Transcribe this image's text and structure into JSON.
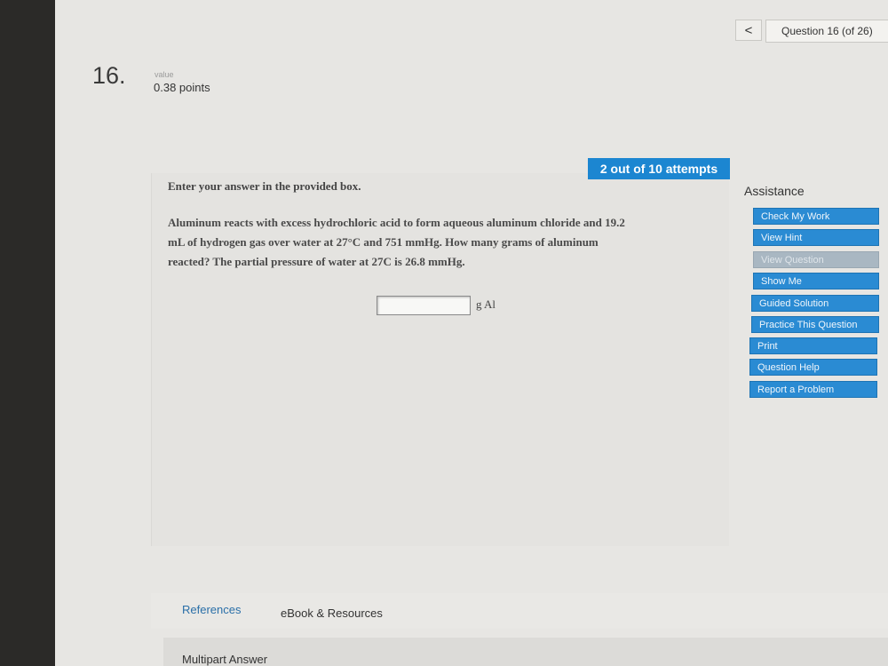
{
  "nav": {
    "prev_symbol": "<",
    "question_counter": "Question 16 (of 26)"
  },
  "question": {
    "number": "16.",
    "value_label": "value",
    "points": "0.38 points",
    "attempts": "2 out of 10 attempts",
    "instruction": "Enter your answer in the provided box.",
    "lines": [
      "Aluminum reacts with excess hydrochloric acid to form aqueous aluminum chloride and 19.2",
      "mL of hydrogen gas over water at 27°C and 751 mmHg. How many grams of aluminum",
      "reacted? The partial pressure of water at 27C is 26.8 mmHg."
    ],
    "answer_value": "",
    "answer_unit": "g Al"
  },
  "assistance": {
    "title": "Assistance",
    "buttons": [
      {
        "label": "Check My Work",
        "enabled": true
      },
      {
        "label": "View Hint",
        "enabled": true
      },
      {
        "label": "View Question",
        "enabled": false
      },
      {
        "label": "Show Me",
        "enabled": true
      },
      {
        "label": "Guided Solution",
        "enabled": true
      },
      {
        "label": "Practice This Question",
        "enabled": true
      },
      {
        "label": "Print",
        "enabled": true
      },
      {
        "label": "Question Help",
        "enabled": true
      },
      {
        "label": "Report a Problem",
        "enabled": true
      }
    ]
  },
  "bottom": {
    "references": "References",
    "ebook": "eBook & Resources",
    "multipart": "Multipart Answer"
  }
}
